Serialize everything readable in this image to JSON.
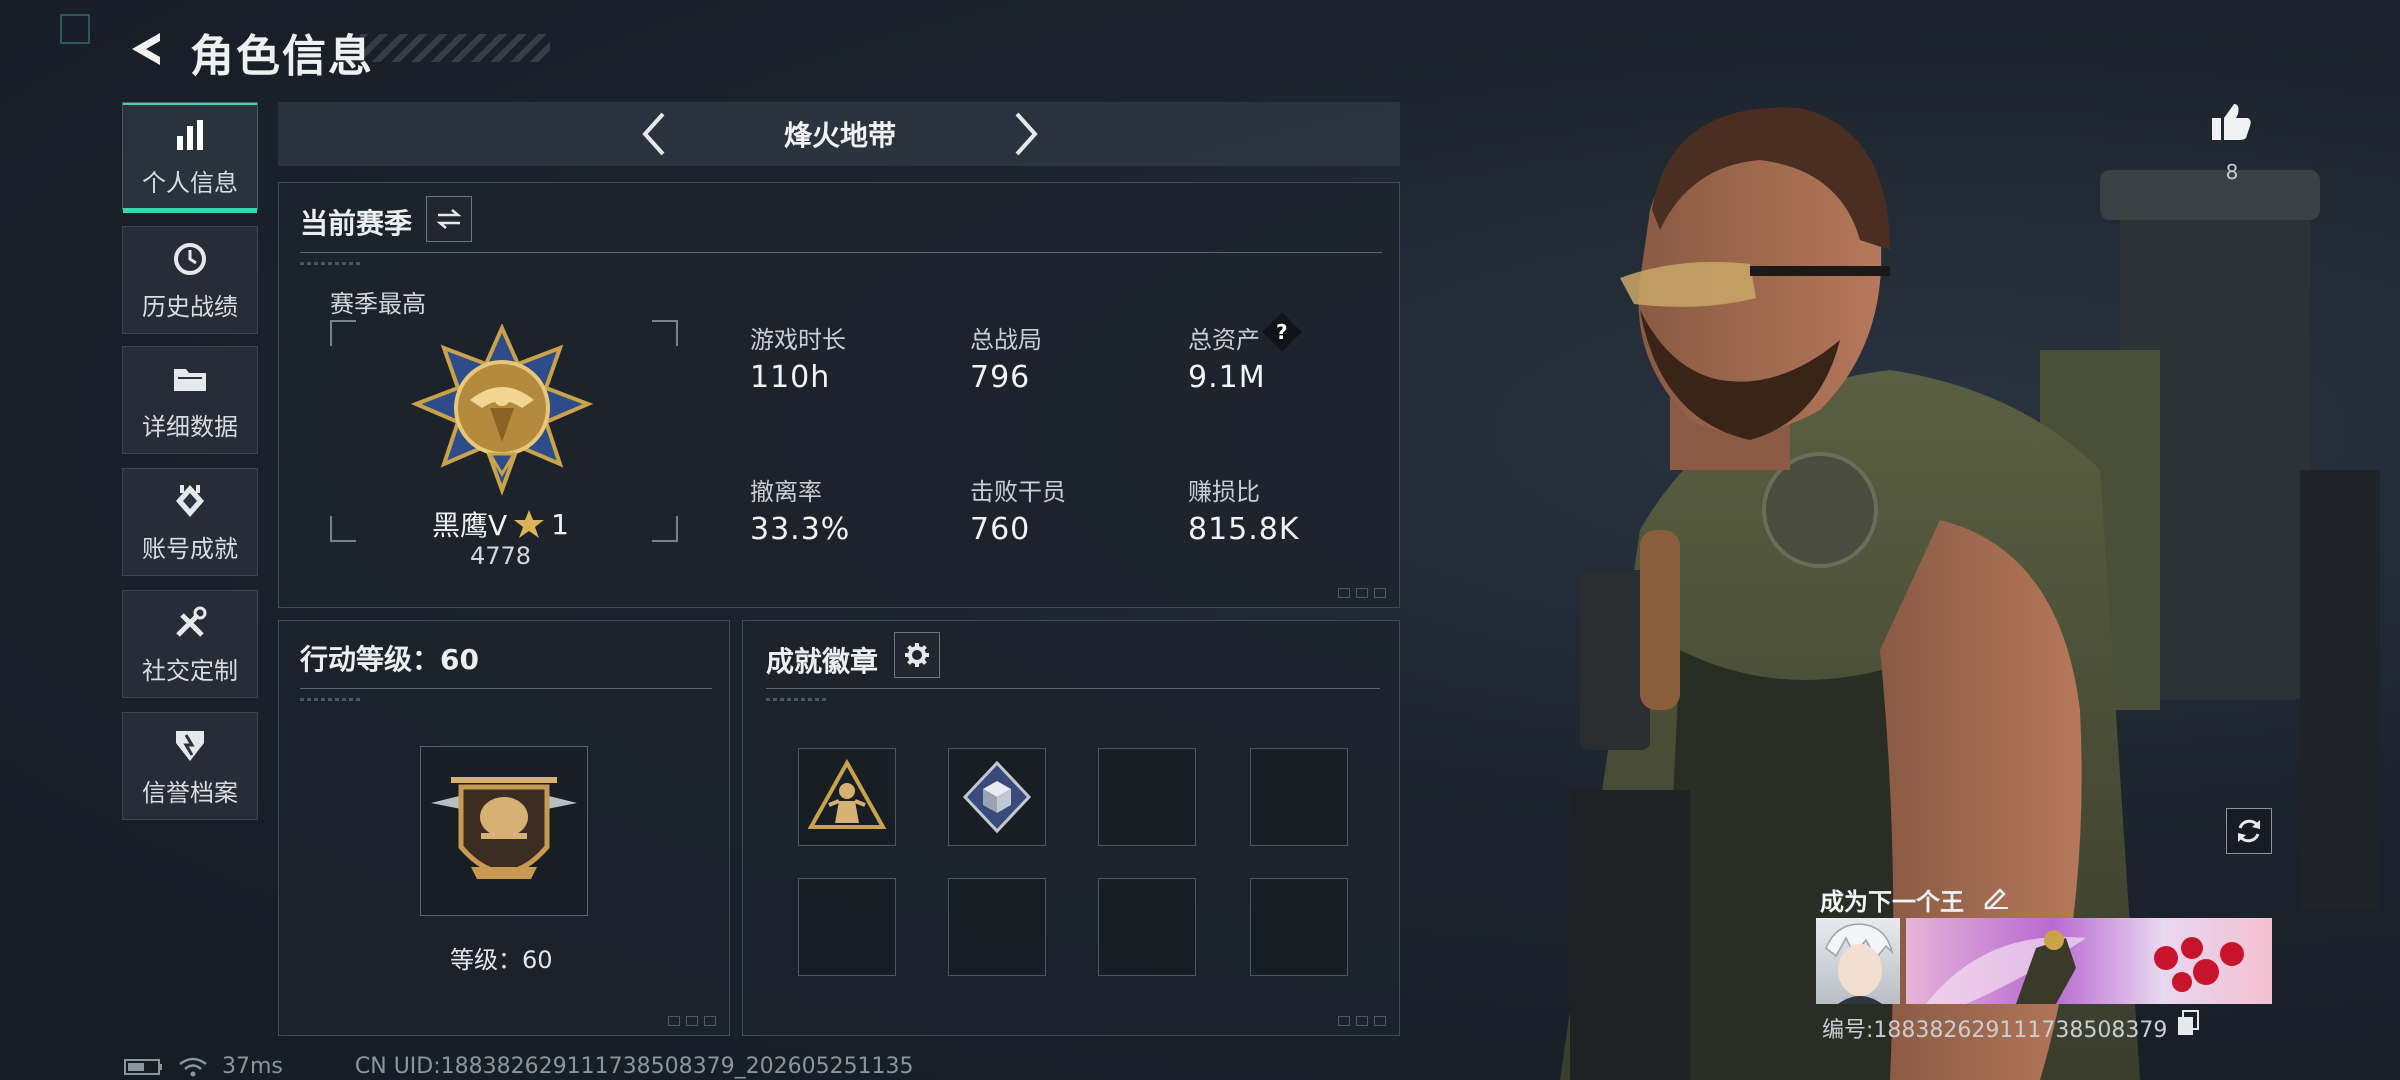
{
  "header": {
    "title": "角色信息"
  },
  "sidebar": {
    "items": [
      {
        "label": "个人信息",
        "icon": "bar-chart-icon",
        "active": true
      },
      {
        "label": "历史战绩",
        "icon": "history-icon"
      },
      {
        "label": "详细数据",
        "icon": "folder-icon"
      },
      {
        "label": "账号成就",
        "icon": "achievement-icon"
      },
      {
        "label": "社交定制",
        "icon": "tools-icon"
      },
      {
        "label": "信誉档案",
        "icon": "credit-shield-icon"
      }
    ]
  },
  "mode": {
    "name": "烽火地带"
  },
  "season": {
    "title": "当前赛季",
    "best_label": "赛季最高",
    "rank_name": "黑鹰V",
    "rank_stars": "1",
    "rank_score": "4778",
    "stats": [
      {
        "label": "游戏时长",
        "value": "110h"
      },
      {
        "label": "总战局",
        "value": "796"
      },
      {
        "label": "总资产",
        "value": "9.1M",
        "help": "?"
      },
      {
        "label": "撤离率",
        "value": "33.3%"
      },
      {
        "label": "击败干员",
        "value": "760"
      },
      {
        "label": "赚损比",
        "value": "815.8K"
      }
    ]
  },
  "action_level": {
    "title": "行动等级：60",
    "level_label": "等级：60"
  },
  "badges": {
    "title": "成就徽章",
    "slots": [
      {
        "icon": "soldier-triangle-badge-icon"
      },
      {
        "icon": "cube-diamond-badge-icon"
      },
      {
        "icon": ""
      },
      {
        "icon": ""
      },
      {
        "icon": ""
      },
      {
        "icon": ""
      },
      {
        "icon": ""
      },
      {
        "icon": ""
      }
    ]
  },
  "profile": {
    "likes": "8",
    "slogan": "成为下一个王",
    "card_number": "编号:1883826291117385083​79"
  },
  "status": {
    "ping": "37ms",
    "uid": "CN UID:1883826291117385083​79_202605251135"
  },
  "colors": {
    "accent": "#3fd3b0",
    "panel_border": "#414b56",
    "gold": "#c9a24a"
  }
}
